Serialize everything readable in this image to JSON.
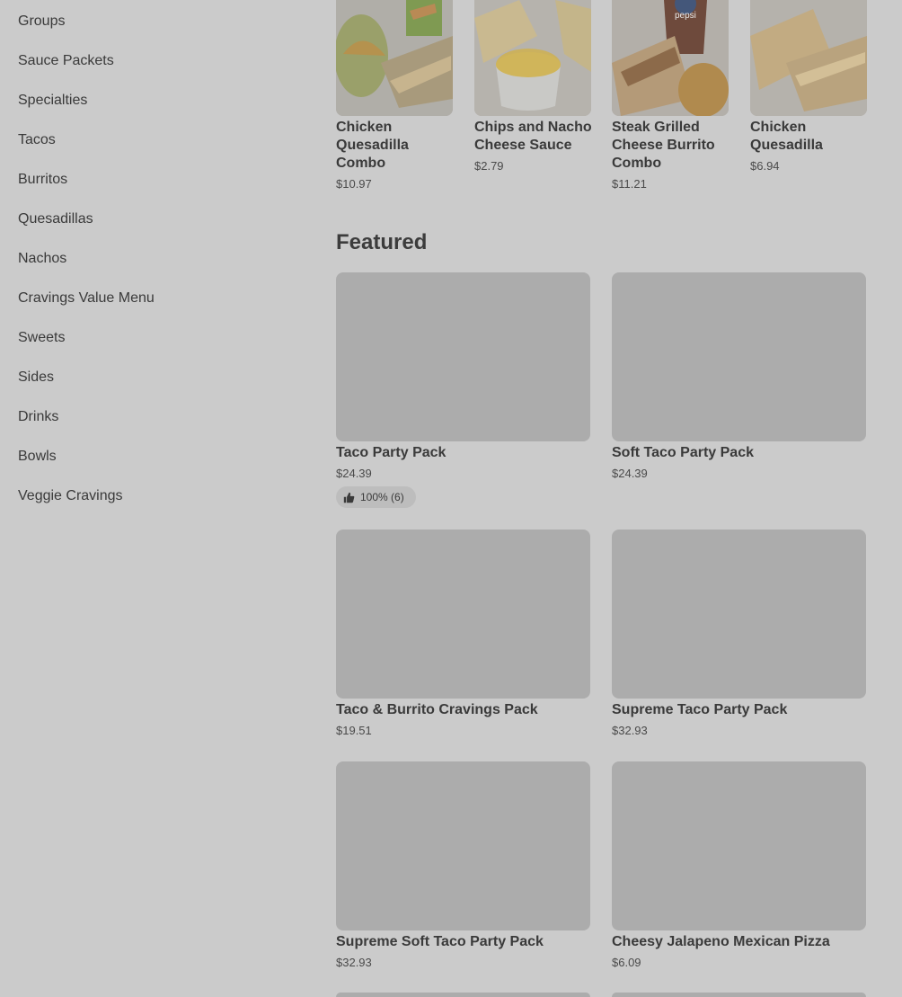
{
  "sidebar": {
    "items": [
      {
        "label": "Groups"
      },
      {
        "label": "Sauce Packets"
      },
      {
        "label": "Specialties"
      },
      {
        "label": "Tacos"
      },
      {
        "label": "Burritos"
      },
      {
        "label": "Quesadillas"
      },
      {
        "label": "Nachos"
      },
      {
        "label": "Cravings Value Menu"
      },
      {
        "label": "Sweets"
      },
      {
        "label": "Sides"
      },
      {
        "label": "Drinks"
      },
      {
        "label": "Bowls"
      },
      {
        "label": "Veggie Cravings"
      }
    ]
  },
  "carousel": {
    "items": [
      {
        "name": "Chicken Quesadilla Combo",
        "price": "$10.97",
        "image": "chicken-quesadilla-combo-image"
      },
      {
        "name": "Chips and Nacho Cheese Sauce",
        "price": "$2.79",
        "image": "chips-nacho-cheese-image"
      },
      {
        "name": "Steak Grilled Cheese Burrito Combo",
        "price": "$11.21",
        "image": "steak-burrito-combo-image",
        "drink_text": "pepsi"
      },
      {
        "name": "Chicken Quesadilla",
        "price": "$6.94",
        "image": "chicken-quesadilla-image"
      }
    ]
  },
  "featured": {
    "title": "Featured",
    "items": [
      {
        "name": "Taco Party Pack",
        "price": "$24.39",
        "rating": "100% (6)"
      },
      {
        "name": "Soft Taco Party Pack",
        "price": "$24.39"
      },
      {
        "name": "Taco & Burrito Cravings Pack",
        "price": "$19.51"
      },
      {
        "name": "Supreme Taco Party Pack",
        "price": "$32.93"
      },
      {
        "name": "Supreme Soft Taco Party Pack",
        "price": "$32.93"
      },
      {
        "name": "Cheesy Jalapeno Mexican Pizza",
        "price": "$6.09"
      }
    ]
  },
  "colors": {
    "overlay_background": "#cbcbcb",
    "placeholder_image": "#acacac",
    "text": "#3a3a3a"
  }
}
